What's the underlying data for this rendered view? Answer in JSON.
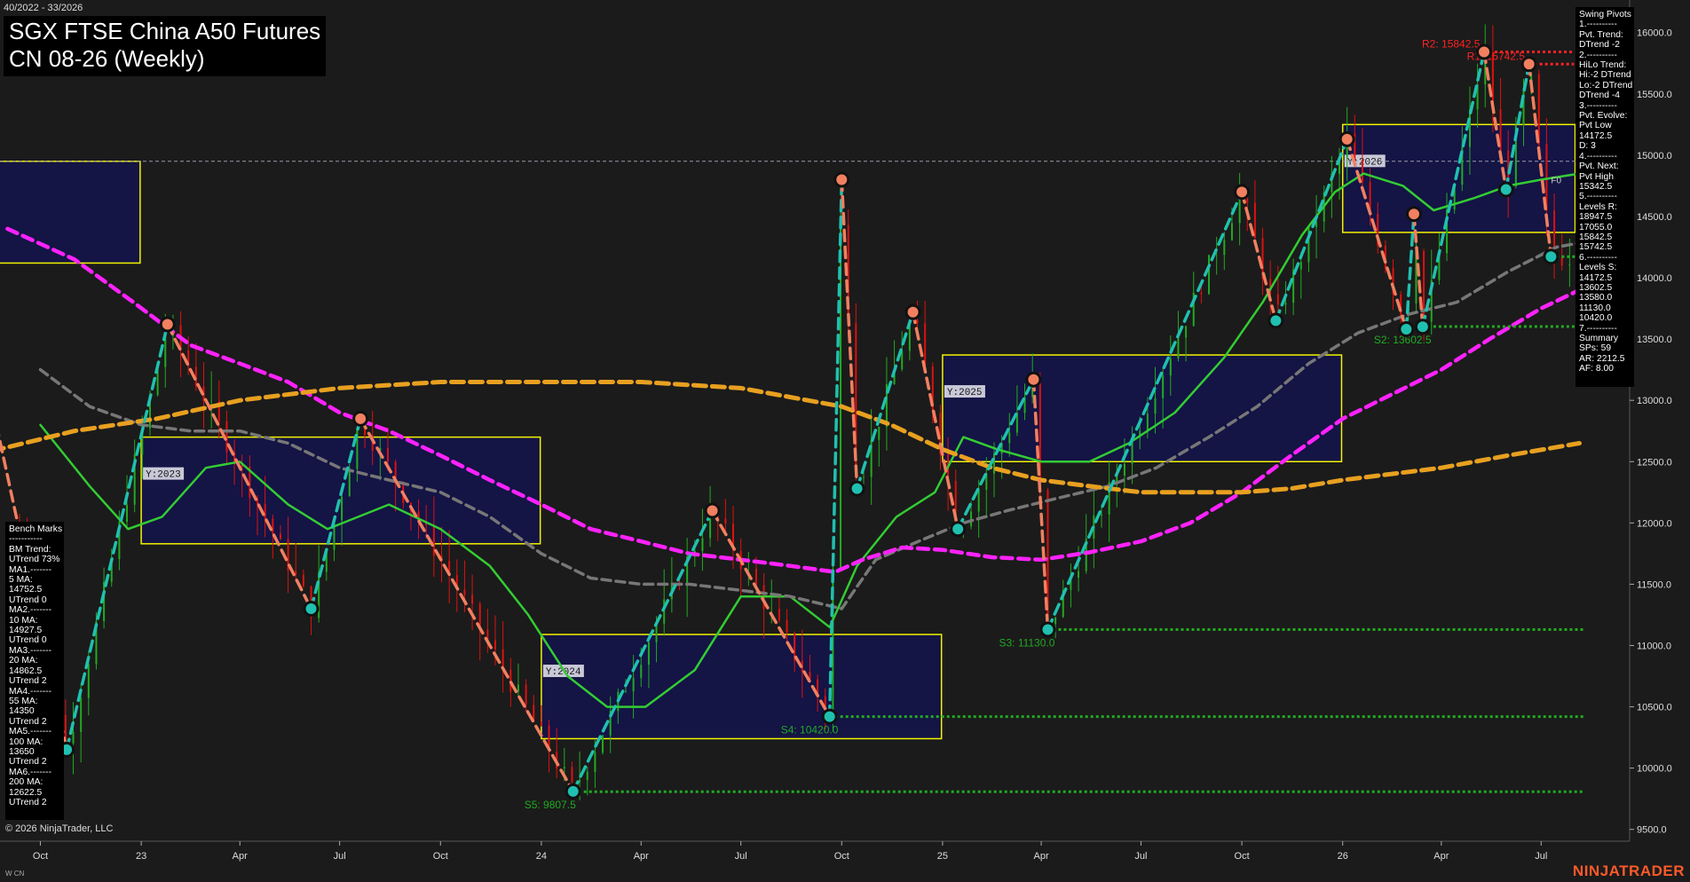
{
  "header": {
    "date_range": "40/2022 - 33/2026",
    "title_line1": "SGX FTSE China A50 Futures",
    "title_line2": "CN 08-26 (Weekly)"
  },
  "footer": {
    "copyright": "© 2026 NinjaTrader, LLC",
    "instrument_code": "W CN",
    "brand": "NINJATRADER"
  },
  "swing_pivots": [
    "Swing Pivots",
    "1.----------",
    "Pvt. Trend:",
    "DTrend -2",
    "2.----------",
    "HiLo Trend:",
    "Hi:-2 DTrend",
    "Lo:-2 DTrend",
    "DTrend -4",
    "3.----------",
    "Pvt. Evolve:",
    "Pvt Low",
    "14172.5",
    "D: 3",
    "4.----------",
    "Pvt. Next:",
    "Pvt High",
    "15342.5",
    "5.----------",
    "Levels R:",
    "18947.5",
    "17055.0",
    "15842.5",
    "15742.5",
    "6.----------",
    "Levels S:",
    "14172.5",
    "13602.5",
    "13580.0",
    "11130.0",
    "10420.0",
    "7.----------",
    "Summary",
    "SPs: 59",
    "AR: 2212.5",
    "AF: 8.00"
  ],
  "bench_marks": [
    "Bench Marks",
    "-----------",
    "BM Trend:",
    "UTrend 73%",
    "MA1.-------",
    "5 MA:",
    "14752.5",
    "UTrend 0",
    "MA2.-------",
    "10 MA:",
    "14927.5",
    "UTrend 0",
    "MA3.-------",
    "20 MA:",
    "14862.5",
    "UTrend 2",
    "MA4.-------",
    "55 MA:",
    "14350",
    "UTrend 2",
    "MA5.-------",
    "100 MA:",
    "13650",
    "UTrend 2",
    "MA6.-------",
    "200 MA:",
    "12622.5",
    "UTrend 2"
  ],
  "chart_data": {
    "type": "line",
    "title": "SGX FTSE China A50 Futures CN 08-26 (Weekly)",
    "y_axis": {
      "ticks": [
        9500,
        10000,
        10500,
        11000,
        11500,
        12000,
        12500,
        13000,
        13500,
        14000,
        14500,
        15000,
        15500,
        16000
      ],
      "tick_labels": [
        "9500.0",
        "10000.0",
        "10500.0",
        "11000.0",
        "11500.0",
        "12000.0",
        "12500.0",
        "13000.0",
        "13500.0",
        "14000.0",
        "14500.0",
        "15000.0",
        "15500.0",
        "16000.0"
      ],
      "range": [
        9440,
        16150
      ]
    },
    "x_axis": {
      "range": [
        "2022-10-01",
        "2026-08-20"
      ],
      "ticks": [
        {
          "date": "2022-10-01",
          "label": "Oct"
        },
        {
          "date": "2023-01-01",
          "label": "23"
        },
        {
          "date": "2023-04-01",
          "label": "Apr"
        },
        {
          "date": "2023-07-01",
          "label": "Jul"
        },
        {
          "date": "2023-10-01",
          "label": "Oct"
        },
        {
          "date": "2024-01-01",
          "label": "24"
        },
        {
          "date": "2024-04-01",
          "label": "Apr"
        },
        {
          "date": "2024-07-01",
          "label": "Jul"
        },
        {
          "date": "2024-10-01",
          "label": "Oct"
        },
        {
          "date": "2025-01-01",
          "label": "25"
        },
        {
          "date": "2025-04-01",
          "label": "Apr"
        },
        {
          "date": "2025-07-01",
          "label": "Jul"
        },
        {
          "date": "2025-10-01",
          "label": "Oct"
        },
        {
          "date": "2026-01-01",
          "label": "26"
        },
        {
          "date": "2026-04-01",
          "label": "Apr"
        },
        {
          "date": "2026-07-01",
          "label": "Jul"
        }
      ]
    },
    "colors": {
      "background": "#1b1b1b",
      "axis_text": "#dddddd",
      "up_candle": "#22aa22",
      "down_candle": "#dd1111",
      "ma_fast": "#33cc33",
      "ma_55": "#777777",
      "ma_100": "#ff22ff",
      "ma_200": "#e8a020",
      "year_box_fill": "#141448",
      "year_box_stroke": "#ffff00",
      "swing_up": "#20c0b0",
      "swing_down": "#f08060",
      "support": "#22aa22",
      "resistance": "#ff2222"
    },
    "year_boxes": [
      {
        "label": "",
        "from": "2022-07-01",
        "to": "2022-12-31",
        "high": 14950,
        "low": 14120
      },
      {
        "label": "Y:2023",
        "from": "2023-01-01",
        "to": "2023-12-31",
        "high": 12700,
        "low": 11830
      },
      {
        "label": "Y:2024",
        "from": "2024-01-01",
        "to": "2024-12-31",
        "high": 11090,
        "low": 10240
      },
      {
        "label": "Y:2025",
        "from": "2025-01-01",
        "to": "2025-12-31",
        "high": 13370,
        "low": 12500
      },
      {
        "label": "Y:2026",
        "from": "2026-01-01",
        "to": "2026-07-31",
        "high": 15250,
        "low": 14370
      }
    ],
    "ma_series": [
      {
        "name": "20 MA",
        "style": "solid",
        "points": [
          [
            "2022-10-01",
            12800
          ],
          [
            "2022-11-15",
            12300
          ],
          [
            "2022-12-20",
            11950
          ],
          [
            "2023-01-20",
            12050
          ],
          [
            "2023-03-01",
            12450
          ],
          [
            "2023-04-01",
            12500
          ],
          [
            "2023-05-15",
            12150
          ],
          [
            "2023-06-20",
            11950
          ],
          [
            "2023-08-15",
            12150
          ],
          [
            "2023-10-01",
            11950
          ],
          [
            "2023-11-15",
            11650
          ],
          [
            "2023-12-20",
            11250
          ],
          [
            "2024-01-25",
            10750
          ],
          [
            "2024-03-01",
            10500
          ],
          [
            "2024-04-05",
            10500
          ],
          [
            "2024-05-20",
            10800
          ],
          [
            "2024-07-01",
            11400
          ],
          [
            "2024-08-15",
            11400
          ],
          [
            "2024-09-20",
            11150
          ],
          [
            "2024-10-15",
            11650
          ],
          [
            "2024-11-20",
            12050
          ],
          [
            "2024-12-25",
            12250
          ],
          [
            "2025-01-20",
            12700
          ],
          [
            "2025-02-20",
            12600
          ],
          [
            "2025-04-01",
            12500
          ],
          [
            "2025-05-15",
            12500
          ],
          [
            "2025-06-20",
            12650
          ],
          [
            "2025-08-01",
            12900
          ],
          [
            "2025-09-15",
            13350
          ],
          [
            "2025-10-20",
            13800
          ],
          [
            "2025-11-25",
            14350
          ],
          [
            "2025-12-25",
            14700
          ],
          [
            "2026-01-20",
            14850
          ],
          [
            "2026-02-25",
            14750
          ],
          [
            "2026-03-25",
            14550
          ],
          [
            "2026-05-01",
            14650
          ],
          [
            "2026-06-01",
            14750
          ],
          [
            "2026-07-01",
            14800
          ],
          [
            "2026-08-05",
            14850
          ]
        ]
      },
      {
        "name": "55 MA",
        "style": "dashed",
        "points": [
          [
            "2022-10-01",
            13250
          ],
          [
            "2022-11-15",
            12950
          ],
          [
            "2023-01-01",
            12800
          ],
          [
            "2023-02-15",
            12750
          ],
          [
            "2023-04-01",
            12750
          ],
          [
            "2023-05-15",
            12650
          ],
          [
            "2023-07-01",
            12450
          ],
          [
            "2023-08-15",
            12350
          ],
          [
            "2023-10-01",
            12250
          ],
          [
            "2023-11-15",
            12050
          ],
          [
            "2024-01-01",
            11750
          ],
          [
            "2024-02-15",
            11550
          ],
          [
            "2024-04-01",
            11500
          ],
          [
            "2024-05-15",
            11500
          ],
          [
            "2024-07-01",
            11450
          ],
          [
            "2024-08-15",
            11400
          ],
          [
            "2024-10-01",
            11300
          ],
          [
            "2024-11-01",
            11700
          ],
          [
            "2024-12-10",
            11850
          ],
          [
            "2025-01-20",
            12000
          ],
          [
            "2025-03-01",
            12100
          ],
          [
            "2025-04-15",
            12200
          ],
          [
            "2025-06-01",
            12300
          ],
          [
            "2025-07-15",
            12450
          ],
          [
            "2025-09-01",
            12700
          ],
          [
            "2025-10-15",
            12950
          ],
          [
            "2025-12-01",
            13300
          ],
          [
            "2026-01-15",
            13550
          ],
          [
            "2026-03-01",
            13700
          ],
          [
            "2026-04-15",
            13800
          ],
          [
            "2026-06-01",
            14050
          ],
          [
            "2026-07-15",
            14250
          ],
          [
            "2026-08-15",
            14300
          ]
        ]
      },
      {
        "name": "100 MA",
        "style": "dashed",
        "points": [
          [
            "2022-09-01",
            14400
          ],
          [
            "2022-11-01",
            14150
          ],
          [
            "2022-12-25",
            13800
          ],
          [
            "2023-02-15",
            13450
          ],
          [
            "2023-04-01",
            13300
          ],
          [
            "2023-05-15",
            13150
          ],
          [
            "2023-07-01",
            12900
          ],
          [
            "2023-08-15",
            12750
          ],
          [
            "2023-10-01",
            12550
          ],
          [
            "2023-11-15",
            12350
          ],
          [
            "2024-01-01",
            12150
          ],
          [
            "2024-02-15",
            11950
          ],
          [
            "2024-04-01",
            11850
          ],
          [
            "2024-05-15",
            11750
          ],
          [
            "2024-07-01",
            11700
          ],
          [
            "2024-08-15",
            11650
          ],
          [
            "2024-09-25",
            11600
          ],
          [
            "2024-10-20",
            11700
          ],
          [
            "2024-11-25",
            11800
          ],
          [
            "2025-01-01",
            11780
          ],
          [
            "2025-02-15",
            11720
          ],
          [
            "2025-04-01",
            11700
          ],
          [
            "2025-05-15",
            11760
          ],
          [
            "2025-07-01",
            11850
          ],
          [
            "2025-08-15",
            12000
          ],
          [
            "2025-10-01",
            12250
          ],
          [
            "2025-11-15",
            12550
          ],
          [
            "2026-01-01",
            12850
          ],
          [
            "2026-02-15",
            13050
          ],
          [
            "2026-04-01",
            13250
          ],
          [
            "2026-05-15",
            13500
          ],
          [
            "2026-07-01",
            13750
          ],
          [
            "2026-08-05",
            13900
          ]
        ]
      },
      {
        "name": "200 MA",
        "style": "dashed",
        "points": [
          [
            "2022-08-01",
            12550
          ],
          [
            "2022-11-01",
            12750
          ],
          [
            "2023-01-15",
            12850
          ],
          [
            "2023-04-01",
            13000
          ],
          [
            "2023-07-01",
            13100
          ],
          [
            "2023-10-01",
            13150
          ],
          [
            "2024-01-01",
            13150
          ],
          [
            "2024-04-01",
            13150
          ],
          [
            "2024-07-01",
            13100
          ],
          [
            "2024-10-01",
            12950
          ],
          [
            "2024-11-15",
            12800
          ],
          [
            "2025-01-01",
            12600
          ],
          [
            "2025-02-15",
            12450
          ],
          [
            "2025-04-01",
            12350
          ],
          [
            "2025-05-15",
            12300
          ],
          [
            "2025-07-01",
            12250
          ],
          [
            "2025-08-15",
            12250
          ],
          [
            "2025-10-01",
            12250
          ],
          [
            "2025-11-15",
            12280
          ],
          [
            "2026-01-01",
            12350
          ],
          [
            "2026-02-15",
            12400
          ],
          [
            "2026-04-01",
            12450
          ],
          [
            "2026-06-01",
            12550
          ],
          [
            "2026-08-05",
            12650
          ]
        ]
      }
    ],
    "swing_pivots_path": [
      {
        "date": "2022-07-01",
        "value": 14950,
        "type": "high"
      },
      {
        "date": "2022-10-25",
        "value": 10150,
        "type": "low"
      },
      {
        "date": "2023-01-25",
        "value": 13620,
        "type": "high"
      },
      {
        "date": "2023-06-05",
        "value": 11300,
        "type": "low"
      },
      {
        "date": "2023-07-20",
        "value": 12850,
        "type": "high"
      },
      {
        "date": "2024-01-30",
        "value": 9810,
        "type": "low"
      },
      {
        "date": "2024-06-05",
        "value": 12100,
        "type": "high"
      },
      {
        "date": "2024-09-20",
        "value": 10420,
        "type": "low"
      },
      {
        "date": "2024-10-01",
        "value": 14800,
        "type": "high"
      },
      {
        "date": "2024-10-15",
        "value": 12280,
        "type": "low"
      },
      {
        "date": "2024-12-05",
        "value": 13720,
        "type": "high"
      },
      {
        "date": "2025-01-15",
        "value": 11950,
        "type": "low"
      },
      {
        "date": "2025-03-25",
        "value": 13170,
        "type": "high"
      },
      {
        "date": "2025-04-07",
        "value": 11130,
        "type": "low"
      },
      {
        "date": "2025-10-01",
        "value": 14700,
        "type": "high"
      },
      {
        "date": "2025-11-01",
        "value": 13650,
        "type": "low"
      },
      {
        "date": "2026-01-05",
        "value": 15130,
        "type": "high"
      },
      {
        "date": "2026-02-28",
        "value": 13580,
        "type": "low"
      },
      {
        "date": "2026-03-07",
        "value": 14520,
        "type": "high"
      },
      {
        "date": "2026-03-15",
        "value": 13600,
        "type": "low"
      },
      {
        "date": "2026-05-10",
        "value": 15842.5,
        "type": "high"
      },
      {
        "date": "2026-05-30",
        "value": 14720,
        "type": "low"
      },
      {
        "date": "2026-06-20",
        "value": 15742.5,
        "type": "high"
      },
      {
        "date": "2026-07-10",
        "value": 14172.5,
        "type": "low"
      }
    ],
    "levels": [
      {
        "label": "R2: 15842.5",
        "value": 15842.5,
        "kind": "resistance",
        "from": "2026-05-10"
      },
      {
        "label": "R1: 15742.5",
        "value": 15742.5,
        "kind": "resistance",
        "from": "2026-06-20"
      },
      {
        "label": "",
        "value": 14172.5,
        "kind": "support",
        "from": "2026-07-10"
      },
      {
        "label": "S2: 13602.5",
        "value": 13602.5,
        "kind": "support",
        "from": "2026-03-15"
      },
      {
        "label": "S3: 11130.0",
        "value": 11130,
        "kind": "support",
        "from": "2025-04-07"
      },
      {
        "label": "S4: 10420.0",
        "value": 10420,
        "kind": "support",
        "from": "2024-09-20"
      },
      {
        "label": "S5: 9807.5",
        "value": 9807.5,
        "kind": "support",
        "from": "2024-01-30"
      }
    ],
    "reference_line": {
      "value": 14950
    },
    "price_marker": {
      "label": "F0",
      "value": 14800
    }
  }
}
